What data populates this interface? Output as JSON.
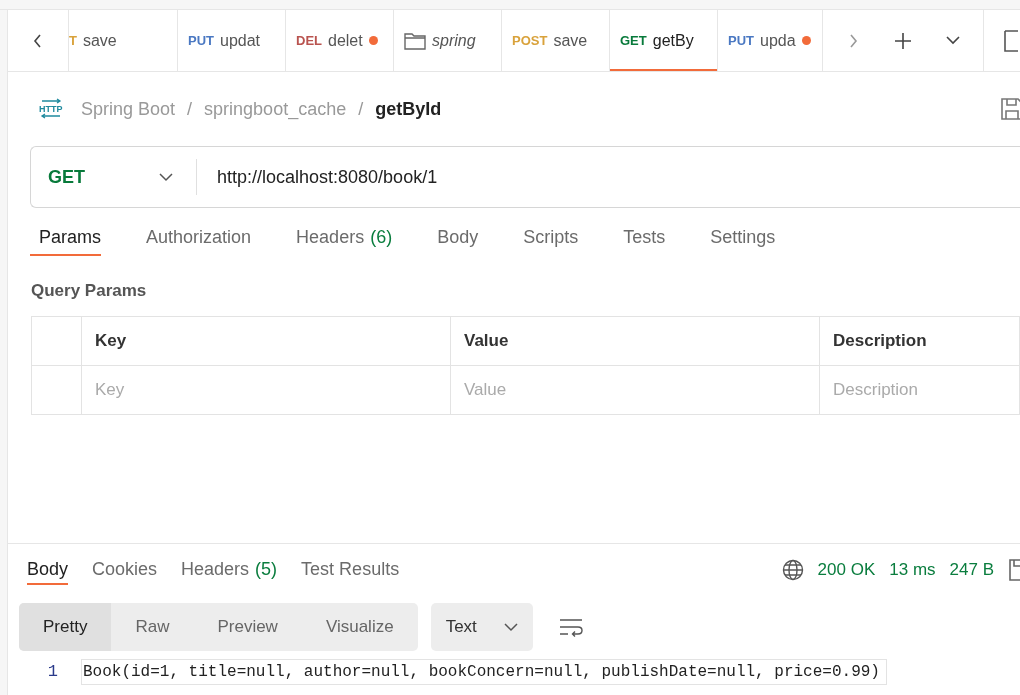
{
  "tabs": [
    {
      "kind": "request",
      "method": "T",
      "name": "save",
      "color": "#d9a23b",
      "selected": false,
      "unsaved": false
    },
    {
      "kind": "request",
      "method": "PUT",
      "name": "updat",
      "color": "#4a78c2",
      "selected": false,
      "unsaved": false
    },
    {
      "kind": "request",
      "method": "DEL",
      "name": "delet",
      "color": "#b9534f",
      "selected": false,
      "unsaved": true
    },
    {
      "kind": "folder",
      "name": "spring",
      "selected": false,
      "unsaved": false
    },
    {
      "kind": "request",
      "method": "POST",
      "name": "save",
      "color": "#d9a23b",
      "selected": false,
      "unsaved": false
    },
    {
      "kind": "request",
      "method": "GET",
      "name": "getBy",
      "color": "#087a3b",
      "selected": true,
      "unsaved": false
    },
    {
      "kind": "request",
      "method": "PUT",
      "name": "upda",
      "color": "#4a78c2",
      "selected": false,
      "unsaved": true
    }
  ],
  "http_badge": "HTTP",
  "breadcrumb": [
    {
      "kind": "item",
      "text": "Spring Boot"
    },
    {
      "kind": "separator",
      "text": "/"
    },
    {
      "kind": "item",
      "text": "springboot_cache"
    },
    {
      "kind": "separator",
      "text": "/"
    },
    {
      "kind": "current",
      "text": "getById"
    }
  ],
  "request": {
    "method": "GET",
    "url": "http://localhost:8080/book/1"
  },
  "request_tabs": [
    {
      "label": "Params",
      "selected": true
    },
    {
      "label": "Authorization",
      "selected": false
    },
    {
      "label": "Headers",
      "count": "(6)",
      "selected": false
    },
    {
      "label": "Body",
      "selected": false
    },
    {
      "label": "Scripts",
      "selected": false
    },
    {
      "label": "Tests",
      "selected": false
    },
    {
      "label": "Settings",
      "selected": false
    }
  ],
  "query_params": {
    "title": "Query Params",
    "columns": [
      "Key",
      "Value",
      "Description"
    ],
    "placeholders": [
      "Key",
      "Value",
      "Description"
    ]
  },
  "response_tabs": [
    {
      "label": "Body",
      "selected": true
    },
    {
      "label": "Cookies",
      "selected": false
    },
    {
      "label": "Headers",
      "count": "(5)",
      "selected": false
    },
    {
      "label": "Test Results",
      "selected": false
    }
  ],
  "response_status": {
    "status": "200 OK",
    "time": "13 ms",
    "size": "247 B"
  },
  "view_modes": [
    {
      "label": "Pretty",
      "selected": true
    },
    {
      "label": "Raw",
      "selected": false
    },
    {
      "label": "Preview",
      "selected": false
    },
    {
      "label": "Visualize",
      "selected": false
    }
  ],
  "format": "Text",
  "code_lines": [
    {
      "number": "1",
      "text": "Book(id=1, title=null, author=null, bookConcern=null, publishDate=null, price=0.99)"
    }
  ]
}
